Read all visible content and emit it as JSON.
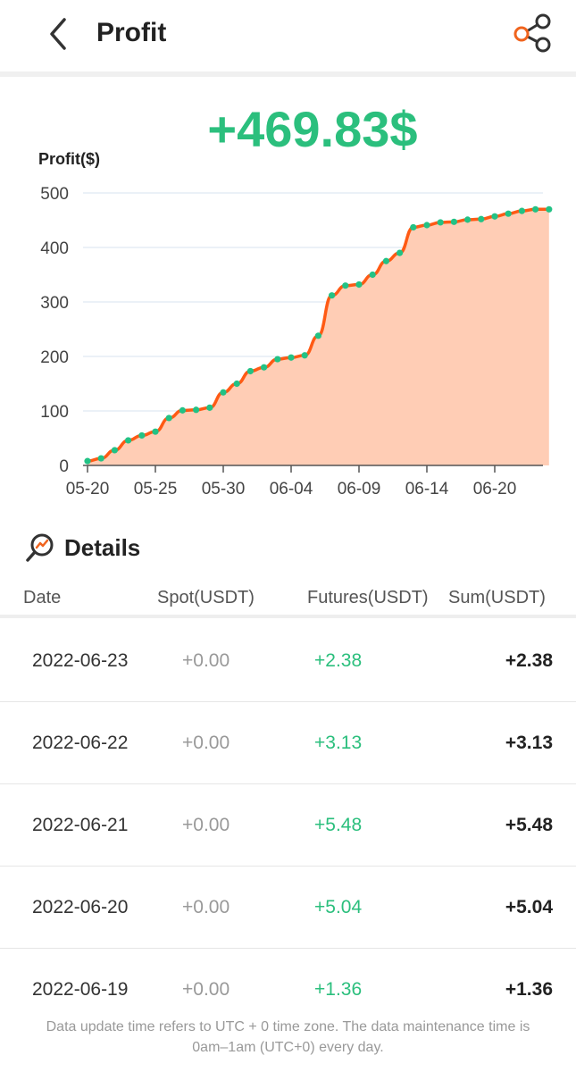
{
  "header": {
    "title": "Profit",
    "back_icon": "chevron-left-icon",
    "share_icon": "share-icon",
    "share_accent": "#f0641e"
  },
  "summary": {
    "total_profit": "+469.83$"
  },
  "chart_data": {
    "type": "area",
    "title": "",
    "ylabel": "Profit($)",
    "xlabel": "",
    "ylim": [
      0,
      500
    ],
    "yticks": [
      0,
      100,
      200,
      300,
      400,
      500
    ],
    "x_tick_labels": [
      "05-20",
      "05-25",
      "05-30",
      "06-04",
      "06-09",
      "06-14",
      "06-20"
    ],
    "x_tick_dates": [
      "2022-05-20",
      "2022-05-25",
      "2022-05-30",
      "2022-06-04",
      "2022-06-09",
      "2022-06-14",
      "2022-06-19"
    ],
    "grid": true,
    "line_color": "#ff5a14",
    "fill_color": "#ffcdb5",
    "point_color": "#22c285",
    "series": [
      {
        "x": [
          "2022-05-20",
          "2022-05-21",
          "2022-05-22",
          "2022-05-23",
          "2022-05-24",
          "2022-05-25",
          "2022-05-26",
          "2022-05-27",
          "2022-05-28",
          "2022-05-29",
          "2022-05-30",
          "2022-05-31",
          "2022-06-01",
          "2022-06-02",
          "2022-06-03",
          "2022-06-04",
          "2022-06-05",
          "2022-06-06",
          "2022-06-07",
          "2022-06-08",
          "2022-06-09",
          "2022-06-10",
          "2022-06-11",
          "2022-06-12",
          "2022-06-13",
          "2022-06-14",
          "2022-06-15",
          "2022-06-16",
          "2022-06-17",
          "2022-06-18",
          "2022-06-19",
          "2022-06-20",
          "2022-06-21",
          "2022-06-22",
          "2022-06-23"
        ],
        "values": [
          8,
          13,
          28,
          46,
          55,
          62,
          87,
          101,
          102,
          106,
          134,
          150,
          173,
          180,
          195,
          198,
          202,
          238,
          312,
          330,
          332,
          350,
          375,
          390,
          437,
          441,
          446,
          447,
          451,
          452,
          457,
          462,
          467,
          470,
          470
        ]
      }
    ]
  },
  "details": {
    "title": "Details",
    "icon": "trend-magnifier-icon",
    "columns": [
      "Date",
      "Spot(USDT)",
      "Futures(USDT)",
      "Sum(USDT)"
    ],
    "rows": [
      {
        "date": "2022-06-23",
        "spot": "+0.00",
        "futures": "+2.38",
        "sum": "+2.38"
      },
      {
        "date": "2022-06-22",
        "spot": "+0.00",
        "futures": "+3.13",
        "sum": "+3.13"
      },
      {
        "date": "2022-06-21",
        "spot": "+0.00",
        "futures": "+5.48",
        "sum": "+5.48"
      },
      {
        "date": "2022-06-20",
        "spot": "+0.00",
        "futures": "+5.04",
        "sum": "+5.04"
      },
      {
        "date": "2022-06-19",
        "spot": "+0.00",
        "futures": "+1.36",
        "sum": "+1.36"
      }
    ]
  },
  "footer": {
    "note_line1": "Data update time refers to UTC + 0 time zone. The data maintenance time is",
    "note_line2": "0am–1am (UTC+0) every day."
  }
}
